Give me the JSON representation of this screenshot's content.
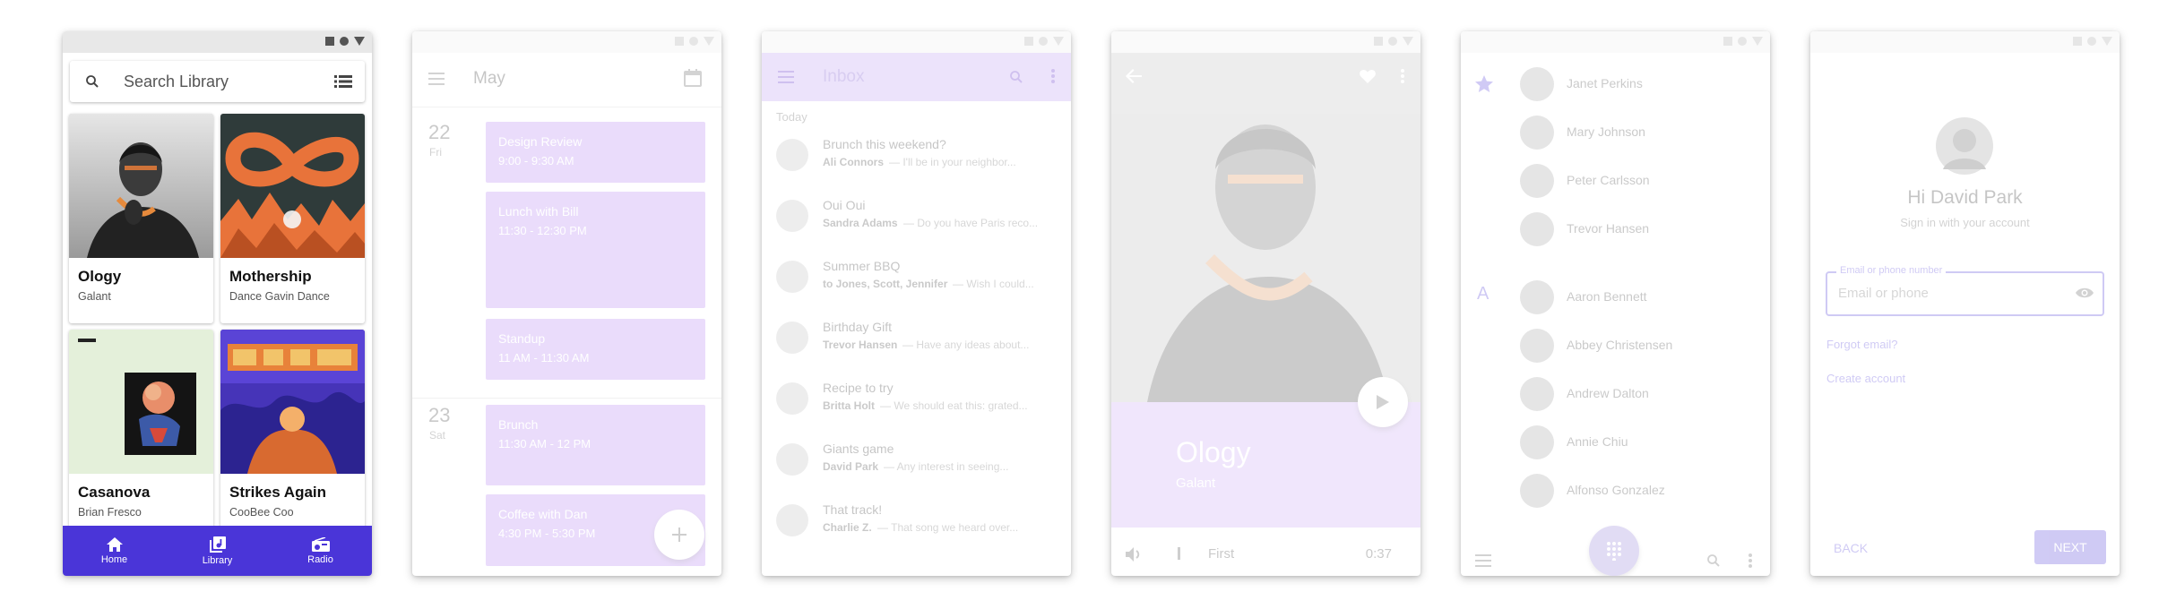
{
  "phone1": {
    "search_placeholder": "Search Library",
    "albums": [
      {
        "title": "Ology",
        "artist": "Galant"
      },
      {
        "title": "Mothership",
        "artist": "Dance Gavin Dance"
      },
      {
        "title": "Casanova",
        "artist": "Brian Fresco"
      },
      {
        "title": "Strikes Again",
        "artist": "CooBee Coo"
      }
    ],
    "nav": [
      {
        "label": "Home",
        "icon": "home-icon"
      },
      {
        "label": "Library",
        "icon": "library-music-icon"
      },
      {
        "label": "Radio",
        "icon": "radio-icon"
      }
    ],
    "colors": {
      "nav_bg": "#4a35d8"
    }
  },
  "phone2": {
    "month": "May",
    "days": [
      {
        "date": "22",
        "weekday": "Fri",
        "events": [
          {
            "title": "Design Review",
            "time": "9:00 - 9:30 AM"
          },
          {
            "title": "Lunch with Bill",
            "time": "11:30 - 12:30 PM"
          },
          {
            "title": "Standup",
            "time": "11 AM - 11:30 AM"
          }
        ]
      },
      {
        "date": "23",
        "weekday": "Sat",
        "events": [
          {
            "title": "Brunch",
            "time": "11:30 AM - 12 PM"
          },
          {
            "title": "Coffee with Dan",
            "time": "4:30 PM - 5:30 PM"
          }
        ]
      }
    ]
  },
  "phone3": {
    "title": "Inbox",
    "section": "Today",
    "emails": [
      {
        "subject": "Brunch this weekend?",
        "sender": "Ali Connors",
        "preview": "I'll be in your neighbor..."
      },
      {
        "subject": "Oui Oui",
        "sender": "Sandra Adams",
        "preview": "Do you have Paris reco..."
      },
      {
        "subject": "Summer BBQ",
        "sender": "to Jones, Scott, Jennifer",
        "preview": "Wish I could..."
      },
      {
        "subject": "Birthday Gift",
        "sender": "Trevor Hansen",
        "preview": "Have any ideas about..."
      },
      {
        "subject": "Recipe to try",
        "sender": "Britta Holt",
        "preview": "We should eat this: grated..."
      },
      {
        "subject": "Giants game",
        "sender": "David Park",
        "preview": "Any interest in seeing..."
      },
      {
        "subject": "That track!",
        "sender": "Charlie Z.",
        "preview": "That song we heard over..."
      }
    ],
    "colors": {
      "header": "#d9c8f7"
    }
  },
  "phone4": {
    "album": "Ology",
    "artist": "Galant",
    "track": "First",
    "time": "0:37",
    "colors": {
      "panel": "#e4d6f7"
    }
  },
  "phone5": {
    "favorites": [
      "Janet Perkins",
      "Mary Johnson",
      "Peter Carlsson",
      "Trevor Hansen"
    ],
    "section_letter": "A",
    "contacts": [
      "Aaron Bennett",
      "Abbey Christensen",
      "Andrew Dalton",
      "Annie Chiu",
      "Alfonso Gonzalez"
    ]
  },
  "phone6": {
    "heading": "Hi David Park",
    "subheading": "Sign in with your account",
    "field_label": "Email or phone number",
    "field_placeholder": "Email or phone",
    "forgot": "Forgot email?",
    "create": "Create account",
    "back": "BACK",
    "next": "NEXT"
  }
}
